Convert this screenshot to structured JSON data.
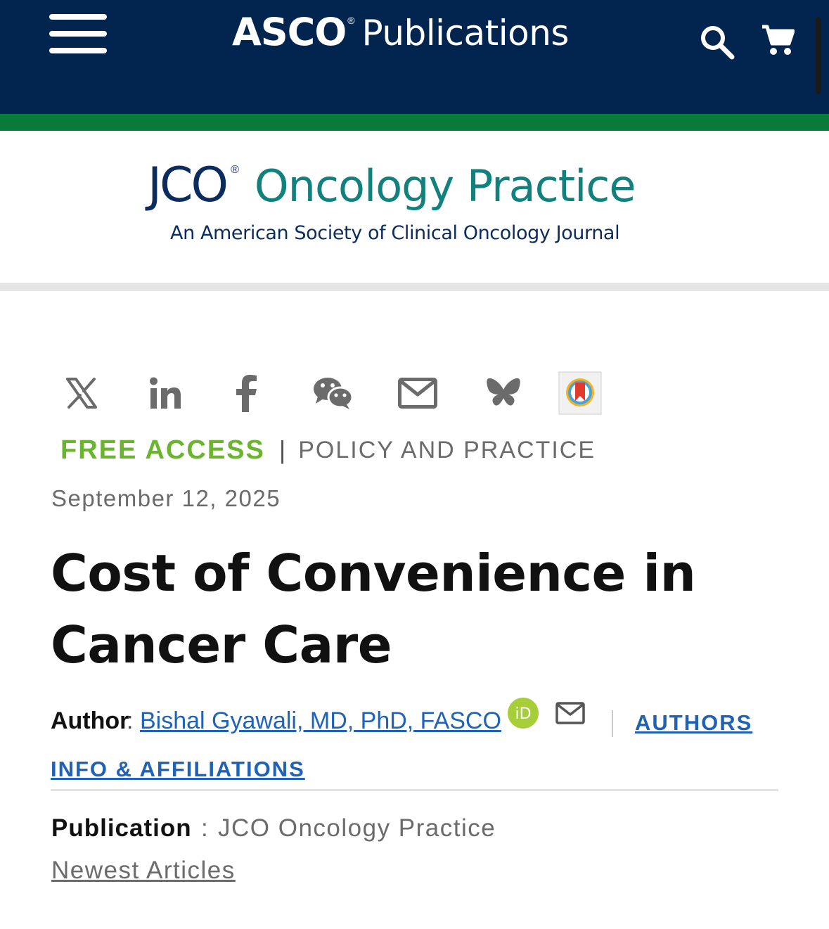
{
  "header": {
    "brand_main": "ASCO",
    "brand_registered": "®",
    "brand_sub": "Publications",
    "menu_icon": "hamburger-menu-icon",
    "search_icon": "search-icon",
    "cart_icon": "shopping-cart-icon",
    "colors": {
      "navy": "#02254f",
      "green_stripe": "#087a3a"
    }
  },
  "journal": {
    "name_abbr": "JCO",
    "registered": "®",
    "name_rest": "Oncology Practice",
    "subtitle": "An American Society of Clinical Oncology Journal"
  },
  "share": {
    "icons": [
      "x-twitter-icon",
      "linkedin-icon",
      "facebook-icon",
      "wechat-icon",
      "email-icon",
      "bluesky-icon",
      "mendeley-icon"
    ]
  },
  "article": {
    "access": "FREE ACCESS",
    "separator": "|",
    "section": "POLICY AND PRACTICE",
    "date": "September 12, 2025",
    "title": "Cost of Convenience in Cancer Care",
    "author_label": "Author",
    "colon": ":",
    "author_name": "Bishal Gyawali, MD, PhD, FASCO",
    "orcid_label": "iD",
    "affiliations_line1": "AUTHORS",
    "affiliations_line2": "INFO & AFFILIATIONS",
    "publication_label": "Publication",
    "publication_name": "JCO Oncology Practice",
    "newest_link": "Newest Articles",
    "colors": {
      "free_access": "#6ab42e",
      "link": "#1f62b6",
      "journal_teal": "#12807c"
    }
  }
}
